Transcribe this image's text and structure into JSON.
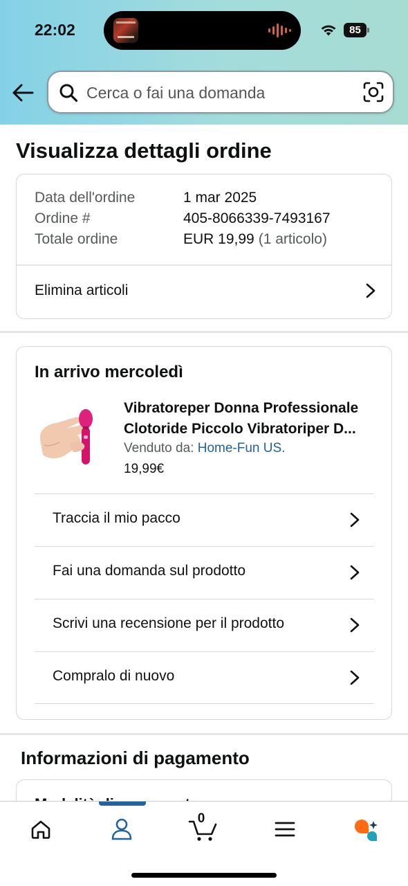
{
  "status_bar": {
    "time": "22:02",
    "battery": "85"
  },
  "search": {
    "placeholder": "Cerca o fai una domanda"
  },
  "page": {
    "title": "Visualizza dettagli ordine"
  },
  "order_summary": {
    "rows": [
      {
        "label": "Data dell'ordine",
        "value": "1 mar 2025",
        "extra": ""
      },
      {
        "label": "Ordine #",
        "value": "405-8066339-7493167",
        "extra": ""
      },
      {
        "label": "Totale ordine",
        "value": "EUR 19,99",
        "extra": "(1 articolo)"
      }
    ],
    "delete_items_label": "Elimina articoli"
  },
  "delivery": {
    "heading": "In arrivo mercoledì",
    "product": {
      "title_line1": "Vibratoreper Donna Professionale",
      "title_line2": "Clotoride Piccolo Vibratoriper D...",
      "sold_by_label": "Venduto da:",
      "seller": "Home-Fun US.",
      "price": "19,99€"
    },
    "actions": [
      {
        "label": "Traccia il mio pacco"
      },
      {
        "label": "Fai una domanda sul prodotto"
      },
      {
        "label": "Scrivi una recensione per il prodotto"
      },
      {
        "label": "Compralo di nuovo"
      }
    ]
  },
  "payment": {
    "heading": "Informazioni di pagamento",
    "partial_text": "Modalità di pagamento"
  },
  "bottom_nav": {
    "active": "account",
    "cart_count": "0",
    "accent_color": "#2162a1",
    "items": [
      "home-icon",
      "account-icon",
      "cart-icon",
      "menu-icon",
      "rufus-icon"
    ]
  },
  "colors": {
    "link": "#2162a1",
    "muted_text": "#565959",
    "primary_text": "#0f1111",
    "border": "#d5d9d9"
  }
}
